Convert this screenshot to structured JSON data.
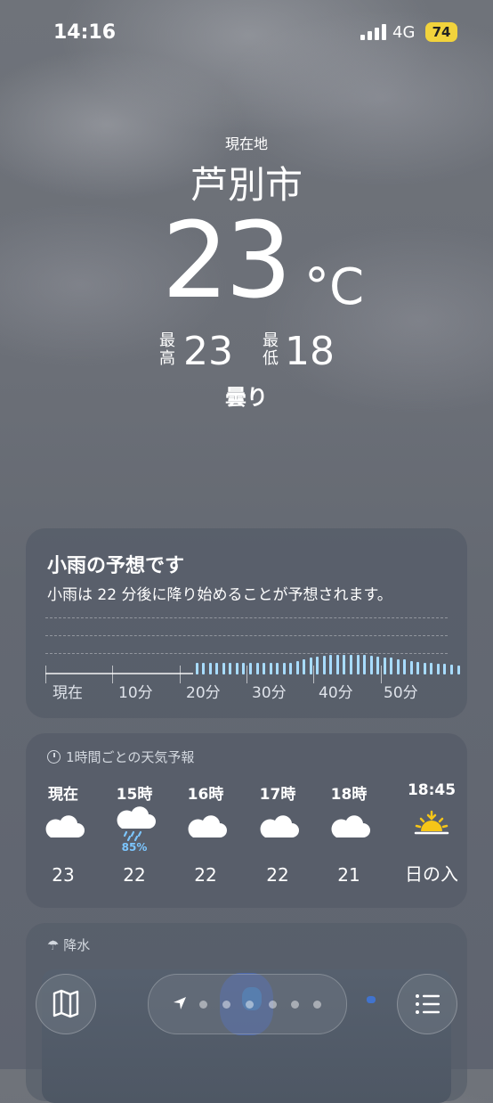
{
  "status": {
    "time": "14:16",
    "network": "4G",
    "battery": "74"
  },
  "location": {
    "label": "現在地",
    "city": "芦別市"
  },
  "current": {
    "temp": "23",
    "unit": "°C",
    "high_label": "最高",
    "high": "23",
    "low_label": "最低",
    "low": "18",
    "condition": "曇り"
  },
  "rain_card": {
    "title": "小雨の予想です",
    "subtitle": "小雨は 22 分後に降り始めることが予想されます。",
    "axis": [
      "現在",
      "10分",
      "20分",
      "30分",
      "40分",
      "50分"
    ],
    "intensity_pct_by_minute_from_22": [
      20,
      20,
      20,
      20,
      20,
      20,
      20,
      20,
      20,
      20,
      20,
      20,
      20,
      20,
      21,
      23,
      26,
      29,
      31,
      33,
      34,
      35,
      35,
      35,
      35,
      34,
      33,
      32,
      30,
      29,
      27,
      26,
      24,
      22,
      21,
      20,
      19,
      18,
      17,
      16
    ]
  },
  "hourly": {
    "header": "1時間ごとの天気予報",
    "items": [
      {
        "hour": "現在",
        "icon": "cloud-icon",
        "temp": "23",
        "pop": ""
      },
      {
        "hour": "15時",
        "icon": "cloud-rain-icon",
        "temp": "22",
        "pop": "85%"
      },
      {
        "hour": "16時",
        "icon": "cloud-icon",
        "temp": "22",
        "pop": ""
      },
      {
        "hour": "17時",
        "icon": "cloud-icon",
        "temp": "22",
        "pop": ""
      },
      {
        "hour": "18時",
        "icon": "cloud-icon",
        "temp": "21",
        "pop": ""
      },
      {
        "hour": "18:45",
        "icon": "sunset-icon",
        "temp": "日の入",
        "pop": ""
      }
    ]
  },
  "precip": {
    "header": "降水"
  },
  "colors": {
    "rain_bar": "#a8dcff",
    "pop": "#7cc6ff",
    "sunset": "#f5c518",
    "battery": "#f2d33c"
  }
}
